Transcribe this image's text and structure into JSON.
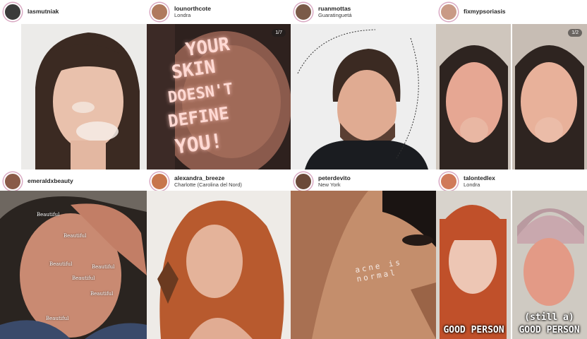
{
  "posts": [
    {
      "username": "lasmutniak",
      "location": ""
    },
    {
      "username": "lounorthcote",
      "location": "Londra",
      "counter": "1/7",
      "overlay": [
        "YOUR",
        "SKIN",
        "DOESN'T",
        "DEFINE",
        "YOU!"
      ]
    },
    {
      "username": "ruanmottas",
      "location": "Guaratinguetá"
    },
    {
      "username": "fixmypsoriasis",
      "location": "",
      "counter": "1/2"
    },
    {
      "username": "emeraldxbeauty",
      "location": "",
      "overlay_word": "Beautiful"
    },
    {
      "username": "alexandra_breeze",
      "location": "Charlotte (Carolina del Nord)"
    },
    {
      "username": "peterdevito",
      "location": "New York",
      "overlay": "acne is normal"
    },
    {
      "username": "talontedlex",
      "location": "Londra",
      "caption_left": "GOOD PERSON",
      "caption_right_top": "(still a)",
      "caption_right_bottom": "GOOD PERSON"
    }
  ]
}
